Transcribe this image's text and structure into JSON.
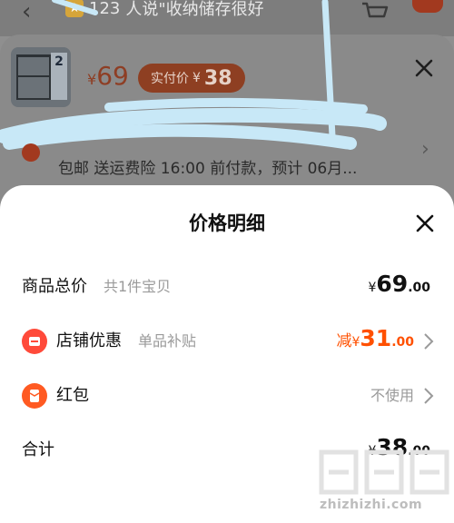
{
  "background": {
    "banner_count": "123",
    "banner_text": "人说\"收纳储存很好",
    "product_price_symbol": "¥",
    "product_price": "69",
    "real_price_label": "实付价",
    "real_price_symbol": "¥",
    "real_price": "38",
    "shipping_text": "包邮  送运费险  16:00 前付款，预计 06月..."
  },
  "sheet": {
    "title": "价格明细",
    "rows": [
      {
        "label": "商品总价",
        "sub": "共1件宝贝",
        "currency": "¥",
        "integer": "69",
        "decimal": ".00"
      },
      {
        "label": "店铺优惠",
        "sub": "单品补贴",
        "prefix": "减",
        "currency": "¥",
        "integer": "31",
        "decimal": ".00"
      },
      {
        "label": "红包",
        "value": "不使用"
      },
      {
        "label": "合计",
        "currency": "¥",
        "integer": "38",
        "decimal": ".00"
      }
    ]
  },
  "watermark": {
    "text": "zhizhizhi.com"
  },
  "colors": {
    "accent": "#ff5000",
    "icon_red": "#ff4a3a",
    "muted": "#9a9a9a"
  },
  "icons": [
    "back-icon",
    "cart-icon",
    "close-icon",
    "shop-icon",
    "red-packet-icon",
    "chevron-right-icon"
  ]
}
